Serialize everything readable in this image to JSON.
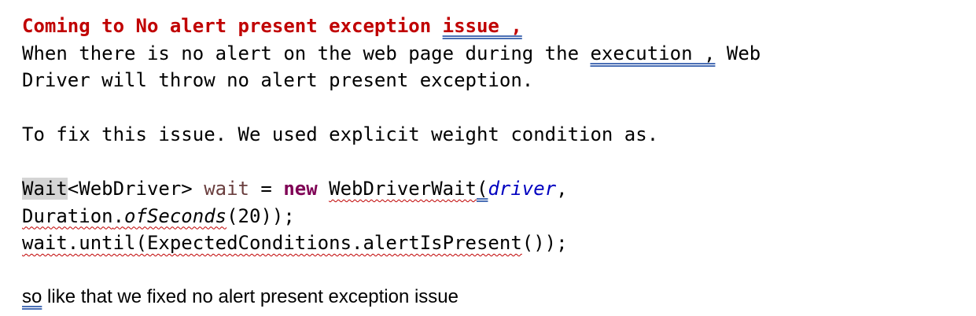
{
  "paragraphs": {
    "heading_text": "Coming to No alert present exception ",
    "heading_marked_word": "issue ,",
    "line1_before": "When there is no alert on the web page during the ",
    "line1_marked_word": "execution ,",
    "line1_after": " Web",
    "line2": "Driver will throw no alert present exception.",
    "fix_line": "To fix this issue. We used explicit weight condition as."
  },
  "code": {
    "type_name": "Wait",
    "type_generic": "<WebDriver> ",
    "var_name": "wait",
    "assign": " = ",
    "keyword_new": "new",
    "space": " ",
    "constructor_name": "WebDriverWait",
    "open_paren": "(",
    "param_driver": "driver",
    "comma": ",",
    "duration_class": "Duration",
    "dot": ".",
    "of_seconds": "ofSeconds",
    "duration_args": "(20));",
    "until_call": "wait.until(ExpectedConditions.alertIsPresent",
    "until_close": "());"
  },
  "closing": {
    "marked_word": "so",
    "rest": " like that we fixed no alert present exception issue"
  },
  "colors": {
    "heading": "#c00000",
    "keyword": "#7f0055",
    "variable": "#6a3e3e",
    "parameter": "#0000c0",
    "highlight": "#d4d4d4",
    "grammar_underline": "#4a6fb5",
    "spelling_underline": "#c00000"
  }
}
